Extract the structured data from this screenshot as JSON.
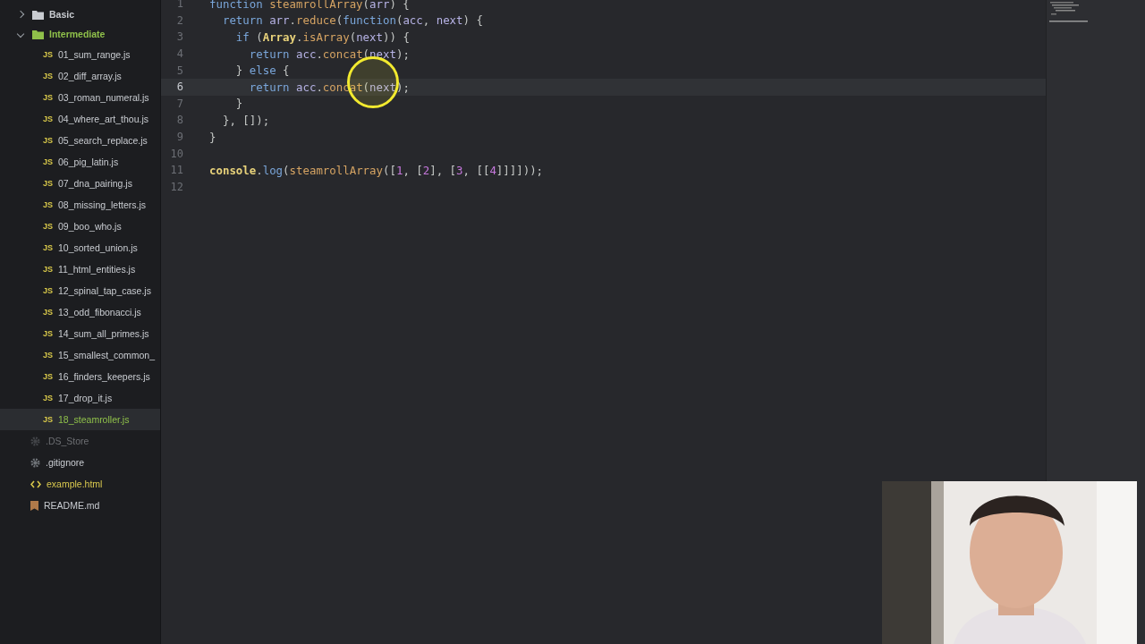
{
  "tree": [
    {
      "name": "Basic",
      "kind": "folder",
      "expanded": false,
      "added": false,
      "modified": false,
      "selected": false,
      "ignored": false
    },
    {
      "name": "Intermediate",
      "kind": "folder",
      "expanded": true,
      "added": true,
      "modified": false,
      "selected": false,
      "ignored": false,
      "children": [
        {
          "name": "01_sum_range.js",
          "kind": "js",
          "badge": "JS",
          "added": false,
          "modified": false,
          "selected": false,
          "ignored": false
        },
        {
          "name": "02_diff_array.js",
          "kind": "js",
          "badge": "JS",
          "added": false,
          "modified": false,
          "selected": false,
          "ignored": false
        },
        {
          "name": "03_roman_numeral.js",
          "kind": "js",
          "badge": "JS",
          "added": false,
          "modified": false,
          "selected": false,
          "ignored": false
        },
        {
          "name": "04_where_art_thou.js",
          "kind": "js",
          "badge": "JS",
          "added": false,
          "modified": false,
          "selected": false,
          "ignored": false
        },
        {
          "name": "05_search_replace.js",
          "kind": "js",
          "badge": "JS",
          "added": false,
          "modified": false,
          "selected": false,
          "ignored": false
        },
        {
          "name": "06_pig_latin.js",
          "kind": "js",
          "badge": "JS",
          "added": false,
          "modified": false,
          "selected": false,
          "ignored": false
        },
        {
          "name": "07_dna_pairing.js",
          "kind": "js",
          "badge": "JS",
          "added": false,
          "modified": false,
          "selected": false,
          "ignored": false
        },
        {
          "name": "08_missing_letters.js",
          "kind": "js",
          "badge": "JS",
          "added": false,
          "modified": false,
          "selected": false,
          "ignored": false
        },
        {
          "name": "09_boo_who.js",
          "kind": "js",
          "badge": "JS",
          "added": false,
          "modified": false,
          "selected": false,
          "ignored": false
        },
        {
          "name": "10_sorted_union.js",
          "kind": "js",
          "badge": "JS",
          "added": false,
          "modified": false,
          "selected": false,
          "ignored": false
        },
        {
          "name": "11_html_entities.js",
          "kind": "js",
          "badge": "JS",
          "added": false,
          "modified": false,
          "selected": false,
          "ignored": false
        },
        {
          "name": "12_spinal_tap_case.js",
          "kind": "js",
          "badge": "JS",
          "added": false,
          "modified": false,
          "selected": false,
          "ignored": false
        },
        {
          "name": "13_odd_fibonacci.js",
          "kind": "js",
          "badge": "JS",
          "added": false,
          "modified": false,
          "selected": false,
          "ignored": false
        },
        {
          "name": "14_sum_all_primes.js",
          "kind": "js",
          "badge": "JS",
          "added": false,
          "modified": false,
          "selected": false,
          "ignored": false
        },
        {
          "name": "15_smallest_common_",
          "kind": "js",
          "badge": "JS",
          "added": false,
          "modified": false,
          "selected": false,
          "ignored": false
        },
        {
          "name": "16_finders_keepers.js",
          "kind": "js",
          "badge": "JS",
          "added": false,
          "modified": false,
          "selected": false,
          "ignored": false
        },
        {
          "name": "17_drop_it.js",
          "kind": "js",
          "badge": "JS",
          "added": false,
          "modified": false,
          "selected": false,
          "ignored": false
        },
        {
          "name": "18_steamroller.js",
          "kind": "js",
          "badge": "JS",
          "added": true,
          "modified": false,
          "selected": true,
          "ignored": false
        }
      ]
    },
    {
      "name": ".DS_Store",
      "kind": "config",
      "added": false,
      "modified": false,
      "selected": false,
      "ignored": true
    },
    {
      "name": ".gitignore",
      "kind": "config",
      "added": false,
      "modified": false,
      "selected": false,
      "ignored": false
    },
    {
      "name": "example.html",
      "kind": "html",
      "added": false,
      "modified": true,
      "selected": false,
      "ignored": false
    },
    {
      "name": "README.md",
      "kind": "markdown",
      "added": false,
      "modified": false,
      "selected": false,
      "ignored": false
    }
  ],
  "editor": {
    "lines": [
      {
        "number": "1",
        "current": false,
        "tokens": [
          {
            "t": "function",
            "kind": "keyword"
          },
          {
            "t": " steamrollArray",
            "kind": "function"
          },
          {
            "t": "(",
            "kind": "plain"
          },
          {
            "t": "arr",
            "kind": "param"
          },
          {
            "t": ") {",
            "kind": "plain"
          }
        ]
      },
      {
        "number": "2",
        "current": false,
        "tokens": [
          {
            "t": "  return",
            "kind": "keyword"
          },
          {
            "t": " arr",
            "kind": "param"
          },
          {
            "t": ".",
            "kind": "plain"
          },
          {
            "t": "reduce",
            "kind": "function"
          },
          {
            "t": "(",
            "kind": "plain"
          },
          {
            "t": "function",
            "kind": "keyword"
          },
          {
            "t": "(",
            "kind": "plain"
          },
          {
            "t": "acc",
            "kind": "param"
          },
          {
            "t": ", ",
            "kind": "plain"
          },
          {
            "t": "next",
            "kind": "param"
          },
          {
            "t": ") {",
            "kind": "plain"
          }
        ]
      },
      {
        "number": "3",
        "current": false,
        "tokens": [
          {
            "t": "    if",
            "kind": "keyword"
          },
          {
            "t": " (",
            "kind": "plain"
          },
          {
            "t": "Array",
            "kind": "builtin"
          },
          {
            "t": ".",
            "kind": "plain"
          },
          {
            "t": "isArray",
            "kind": "function"
          },
          {
            "t": "(",
            "kind": "plain"
          },
          {
            "t": "next",
            "kind": "param"
          },
          {
            "t": ")) {",
            "kind": "plain"
          }
        ]
      },
      {
        "number": "4",
        "current": false,
        "tokens": [
          {
            "t": "      return",
            "kind": "keyword"
          },
          {
            "t": " acc",
            "kind": "param"
          },
          {
            "t": ".",
            "kind": "plain"
          },
          {
            "t": "concat",
            "kind": "function"
          },
          {
            "t": "(",
            "kind": "plain"
          },
          {
            "t": "next",
            "kind": "param"
          },
          {
            "t": ");",
            "kind": "plain"
          }
        ]
      },
      {
        "number": "5",
        "current": false,
        "tokens": [
          {
            "t": "    } ",
            "kind": "plain"
          },
          {
            "t": "else",
            "kind": "keyword"
          },
          {
            "t": " {",
            "kind": "plain"
          }
        ]
      },
      {
        "number": "6",
        "current": true,
        "tokens": [
          {
            "t": "      return",
            "kind": "keyword"
          },
          {
            "t": " acc",
            "kind": "param"
          },
          {
            "t": ".",
            "kind": "plain"
          },
          {
            "t": "concat",
            "kind": "function"
          },
          {
            "t": "(",
            "kind": "plain"
          },
          {
            "t": "next",
            "kind": "param"
          },
          {
            "t": ");",
            "kind": "plain"
          }
        ]
      },
      {
        "number": "7",
        "current": false,
        "tokens": [
          {
            "t": "    }",
            "kind": "plain"
          }
        ]
      },
      {
        "number": "8",
        "current": false,
        "tokens": [
          {
            "t": "  }, []);",
            "kind": "plain"
          }
        ]
      },
      {
        "number": "9",
        "current": false,
        "tokens": [
          {
            "t": "}",
            "kind": "plain"
          }
        ]
      },
      {
        "number": "10",
        "current": false
      },
      {
        "number": "11",
        "current": false,
        "tokens": [
          {
            "t": "console",
            "kind": "builtin"
          },
          {
            "t": ".",
            "kind": "plain"
          },
          {
            "t": "log",
            "kind": "method"
          },
          {
            "t": "(",
            "kind": "plain"
          },
          {
            "t": "steamrollArray",
            "kind": "function"
          },
          {
            "t": "([",
            "kind": "plain"
          },
          {
            "t": "1",
            "kind": "number"
          },
          {
            "t": ", [",
            "kind": "plain"
          },
          {
            "t": "2",
            "kind": "number"
          },
          {
            "t": "], [",
            "kind": "plain"
          },
          {
            "t": "3",
            "kind": "number"
          },
          {
            "t": ", [[",
            "kind": "plain"
          },
          {
            "t": "4",
            "kind": "number"
          },
          {
            "t": "]]]]));",
            "kind": "plain"
          }
        ]
      },
      {
        "number": "12",
        "current": false
      }
    ]
  }
}
